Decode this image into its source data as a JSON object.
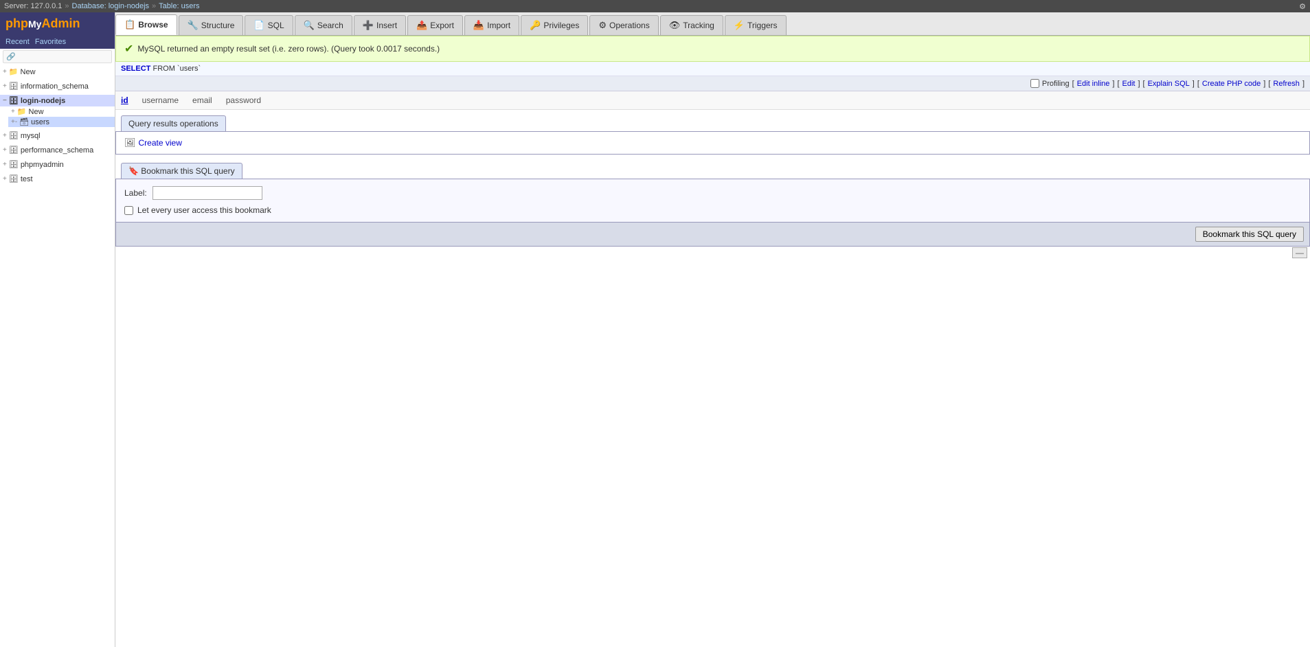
{
  "topbar": {
    "server": "Server: 127.0.0.1",
    "database": "Database: login-nodejs",
    "table": "Table: users",
    "sep1": "»",
    "sep2": "»",
    "settings_icon": "⚙"
  },
  "sidebar": {
    "logo_php": "php",
    "logo_my": "My",
    "logo_admin": "Admin",
    "recent_label": "Recent",
    "favorites_label": "Favorites",
    "link_icon": "🔗",
    "databases": [
      {
        "name": "New",
        "icon": "📁",
        "expanded": false,
        "prefix": "+"
      },
      {
        "name": "information_schema",
        "icon": "🗄",
        "expanded": false,
        "prefix": "+"
      },
      {
        "name": "login-nodejs",
        "icon": "🗄",
        "expanded": true,
        "prefix": "-",
        "children": [
          {
            "name": "New",
            "icon": "📁",
            "active": false,
            "prefix": "+"
          },
          {
            "name": "users",
            "icon": "🗃",
            "active": true,
            "prefix": "+-"
          }
        ]
      },
      {
        "name": "mysql",
        "icon": "🗄",
        "expanded": false,
        "prefix": "+"
      },
      {
        "name": "performance_schema",
        "icon": "🗄",
        "expanded": false,
        "prefix": "+"
      },
      {
        "name": "phpmyadmin",
        "icon": "🗄",
        "expanded": false,
        "prefix": "+"
      },
      {
        "name": "test",
        "icon": "🗄",
        "expanded": false,
        "prefix": "+"
      }
    ]
  },
  "tabs": [
    {
      "label": "Browse",
      "icon": "📋",
      "active": true
    },
    {
      "label": "Structure",
      "icon": "🔧",
      "active": false
    },
    {
      "label": "SQL",
      "icon": "📄",
      "active": false
    },
    {
      "label": "Search",
      "icon": "🔍",
      "active": false
    },
    {
      "label": "Insert",
      "icon": "➕",
      "active": false
    },
    {
      "label": "Export",
      "icon": "📤",
      "active": false
    },
    {
      "label": "Import",
      "icon": "📥",
      "active": false
    },
    {
      "label": "Privileges",
      "icon": "🔑",
      "active": false
    },
    {
      "label": "Operations",
      "icon": "⚙",
      "active": false
    },
    {
      "label": "Tracking",
      "icon": "👁",
      "active": false
    },
    {
      "label": "Triggers",
      "icon": "⚡",
      "active": false
    }
  ],
  "success_banner": {
    "icon": "✔",
    "message": "MySQL returned an empty result set (i.e. zero rows). (Query took 0.0017 seconds.)"
  },
  "sql_query": {
    "keyword_select": "SELECT",
    "rest": "  FROM `users`"
  },
  "profiling": {
    "checkbox_label": "Profiling",
    "edit_inline_label": "Edit inline",
    "edit_label": "Edit",
    "explain_sql_label": "Explain SQL",
    "create_php_label": "Create PHP code",
    "refresh_label": "Refresh",
    "sep1": "[",
    "sep2": "]",
    "sep3": "[",
    "sep4": "]",
    "sep5": "[",
    "sep6": "]",
    "sep7": "[",
    "sep8": "]"
  },
  "columns": {
    "id": "id",
    "username": "username",
    "email": "email",
    "password": "password"
  },
  "query_results_panel": {
    "tab_label": "Query results operations",
    "create_view_label": "Create view",
    "create_view_icon": "🖼"
  },
  "bookmark_panel": {
    "tab_label": "Bookmark this SQL query",
    "bookmark_icon": "🔖",
    "label_text": "Label:",
    "label_placeholder": "",
    "checkbox_label": "Let every user access this bookmark",
    "submit_label": "Bookmark this SQL query"
  },
  "minimize_icon": "—"
}
